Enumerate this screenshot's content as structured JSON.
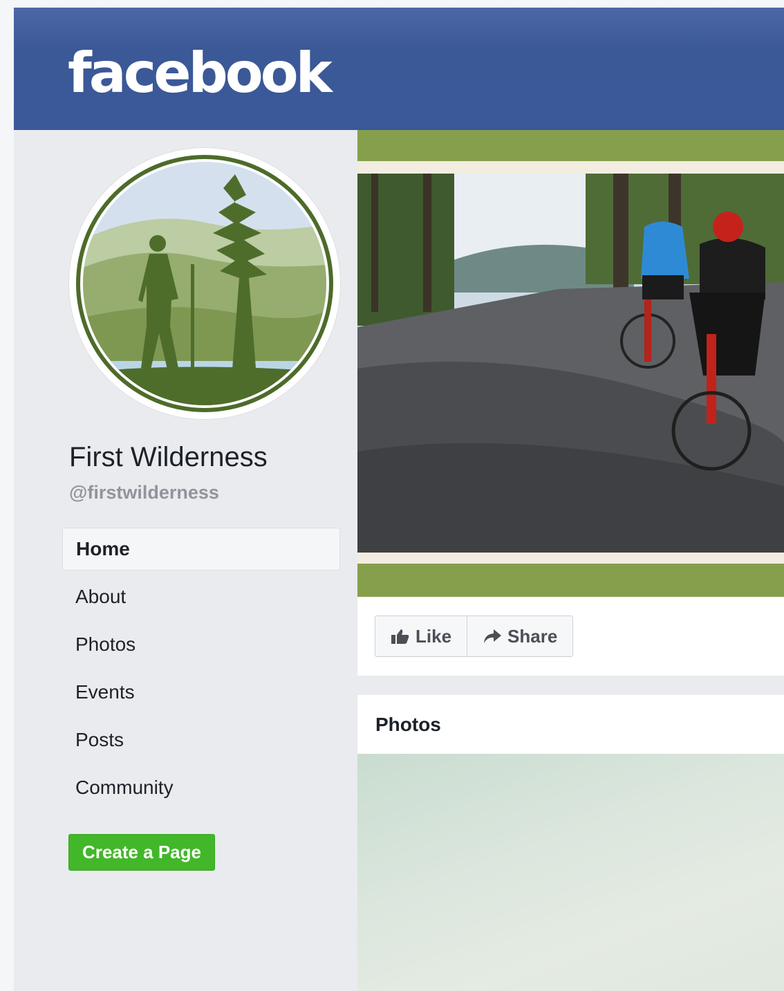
{
  "header": {
    "logo_text": "facebook"
  },
  "profile": {
    "name": "First Wilderness",
    "handle": "@firstwilderness"
  },
  "nav": {
    "items": [
      {
        "label": "Home",
        "active": true
      },
      {
        "label": "About"
      },
      {
        "label": "Photos"
      },
      {
        "label": "Events"
      },
      {
        "label": "Posts"
      },
      {
        "label": "Community"
      }
    ]
  },
  "create_page_label": "Create a Page",
  "actions": {
    "like_label": "Like",
    "share_label": "Share"
  },
  "photos": {
    "title": "Photos"
  },
  "colors": {
    "brand": "#3b5998",
    "accent_green": "#869f4c",
    "create_green": "#42b72a"
  },
  "icons": [
    "thumbs-up-icon",
    "share-arrow-icon"
  ]
}
